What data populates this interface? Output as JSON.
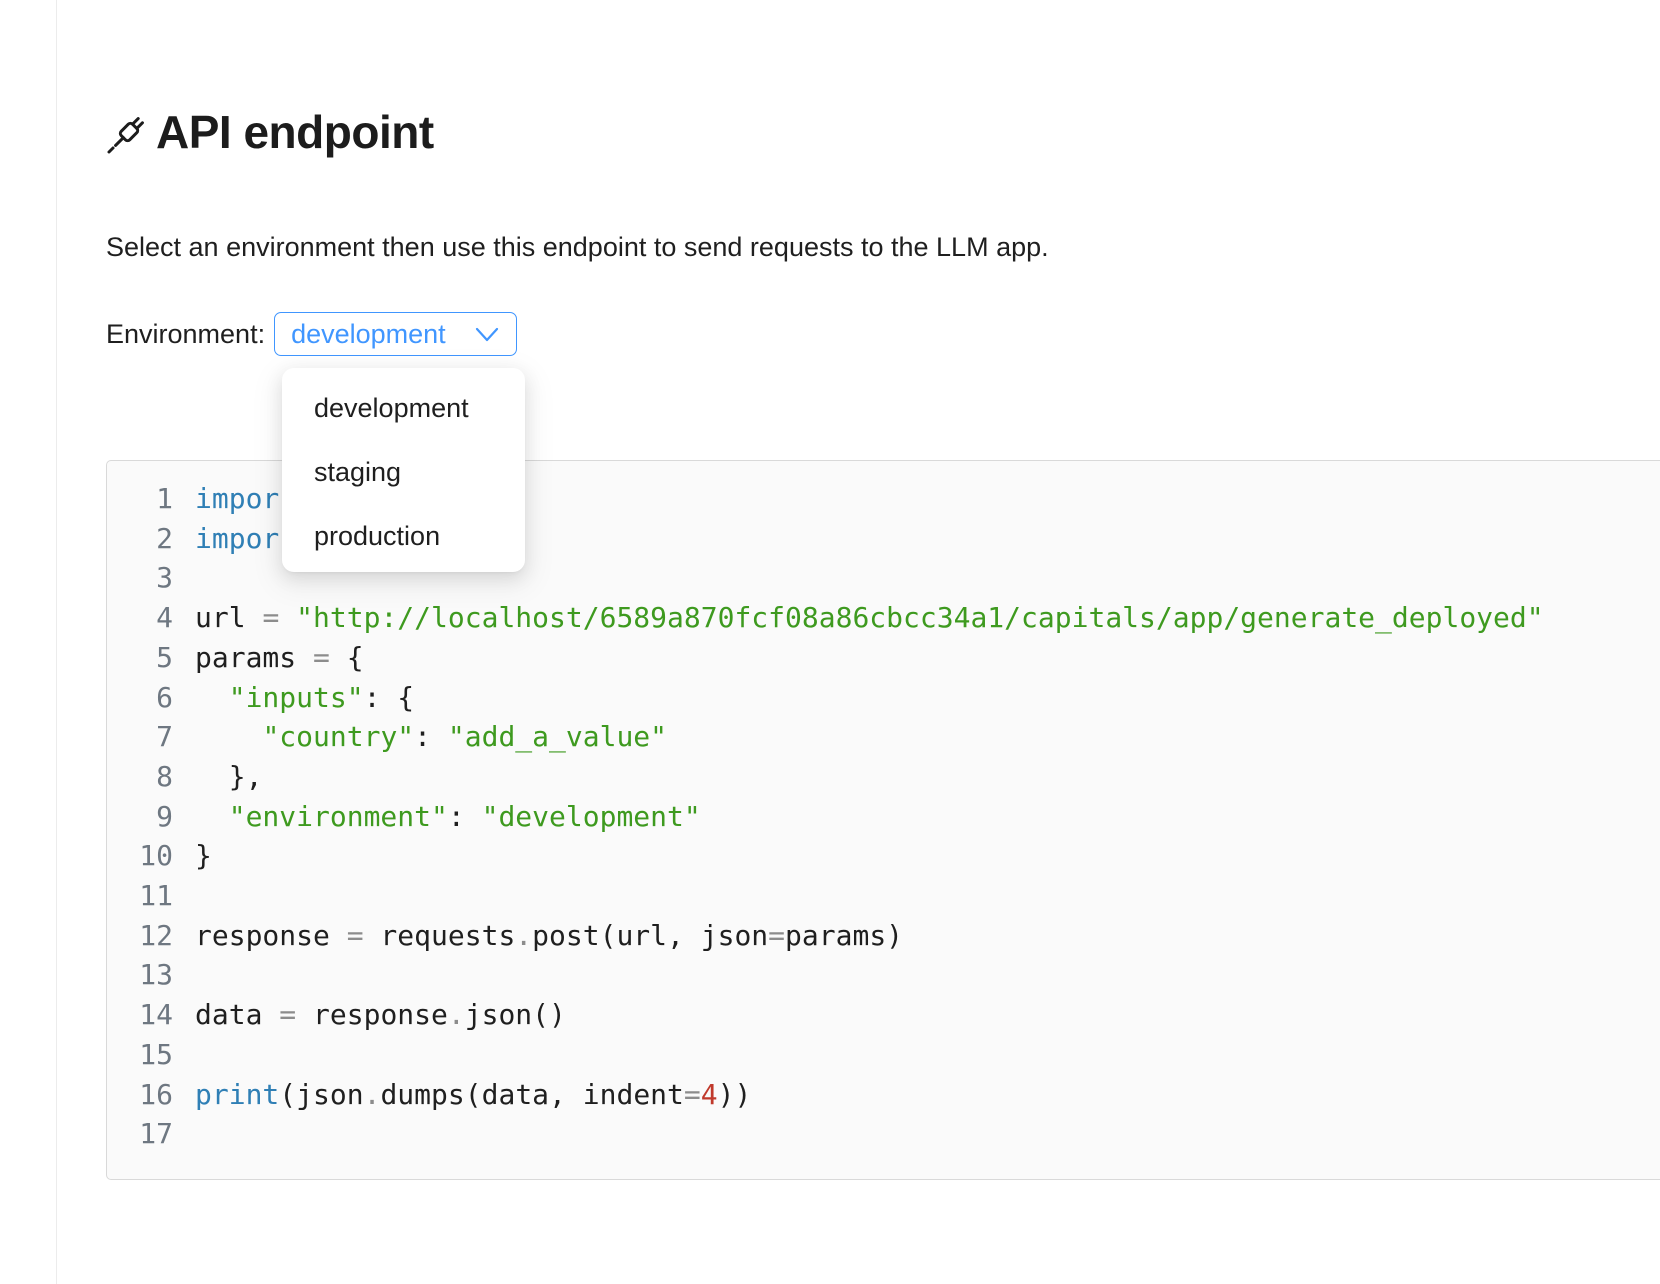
{
  "header": {
    "title": "API endpoint",
    "title_icon": "plug-icon"
  },
  "description": "Select an environment then use this endpoint to send requests to the LLM app.",
  "environment": {
    "label": "Environment:",
    "selected": "development",
    "options": [
      "development",
      "staging",
      "production"
    ]
  },
  "code": {
    "lines": [
      {
        "no": "1",
        "tokens": [
          {
            "t": "kw",
            "v": "impor"
          }
        ]
      },
      {
        "no": "2",
        "tokens": [
          {
            "t": "kw",
            "v": "impor"
          }
        ]
      },
      {
        "no": "3",
        "tokens": []
      },
      {
        "no": "4",
        "tokens": [
          {
            "t": "plain",
            "v": "url "
          },
          {
            "t": "op",
            "v": "="
          },
          {
            "t": "plain",
            "v": " "
          },
          {
            "t": "str",
            "v": "\"http://localhost/6589a870fcf08a86cbcc34a1/capitals/app/generate_deployed\""
          }
        ]
      },
      {
        "no": "5",
        "tokens": [
          {
            "t": "plain",
            "v": "params "
          },
          {
            "t": "op",
            "v": "="
          },
          {
            "t": "plain",
            "v": " {"
          }
        ]
      },
      {
        "no": "6",
        "tokens": [
          {
            "t": "plain",
            "v": "  "
          },
          {
            "t": "str",
            "v": "\"inputs\""
          },
          {
            "t": "plain",
            "v": ": {"
          }
        ]
      },
      {
        "no": "7",
        "tokens": [
          {
            "t": "plain",
            "v": "    "
          },
          {
            "t": "str",
            "v": "\"country\""
          },
          {
            "t": "plain",
            "v": ": "
          },
          {
            "t": "str",
            "v": "\"add_a_value\""
          }
        ]
      },
      {
        "no": "8",
        "tokens": [
          {
            "t": "plain",
            "v": "  },"
          }
        ]
      },
      {
        "no": "9",
        "tokens": [
          {
            "t": "plain",
            "v": "  "
          },
          {
            "t": "str",
            "v": "\"environment\""
          },
          {
            "t": "plain",
            "v": ": "
          },
          {
            "t": "str",
            "v": "\"development\""
          }
        ]
      },
      {
        "no": "10",
        "tokens": [
          {
            "t": "plain",
            "v": "}"
          }
        ]
      },
      {
        "no": "11",
        "tokens": []
      },
      {
        "no": "12",
        "tokens": [
          {
            "t": "plain",
            "v": "response "
          },
          {
            "t": "op",
            "v": "="
          },
          {
            "t": "plain",
            "v": " requests"
          },
          {
            "t": "op",
            "v": "."
          },
          {
            "t": "plain",
            "v": "post(url, json"
          },
          {
            "t": "op",
            "v": "="
          },
          {
            "t": "plain",
            "v": "params)"
          }
        ]
      },
      {
        "no": "13",
        "tokens": []
      },
      {
        "no": "14",
        "tokens": [
          {
            "t": "plain",
            "v": "data "
          },
          {
            "t": "op",
            "v": "="
          },
          {
            "t": "plain",
            "v": " response"
          },
          {
            "t": "op",
            "v": "."
          },
          {
            "t": "plain",
            "v": "json()"
          }
        ]
      },
      {
        "no": "15",
        "tokens": []
      },
      {
        "no": "16",
        "tokens": [
          {
            "t": "kw",
            "v": "print"
          },
          {
            "t": "plain",
            "v": "(json"
          },
          {
            "t": "op",
            "v": "."
          },
          {
            "t": "plain",
            "v": "dumps(data, indent"
          },
          {
            "t": "op",
            "v": "="
          },
          {
            "t": "num",
            "v": "4"
          },
          {
            "t": "plain",
            "v": "))"
          }
        ]
      },
      {
        "no": "17",
        "tokens": []
      }
    ]
  }
}
